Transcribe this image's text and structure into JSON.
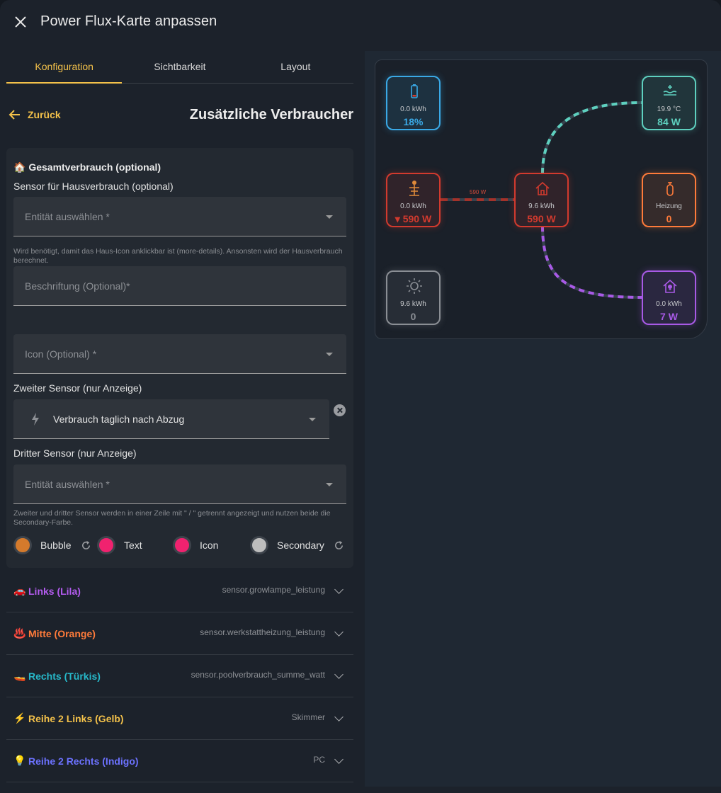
{
  "header": {
    "title": "Power Flux-Karte anpassen",
    "close_icon": "close-icon"
  },
  "tabs": [
    {
      "label": "Konfiguration",
      "active": true
    },
    {
      "label": "Sichtbarkeit",
      "active": false
    },
    {
      "label": "Layout",
      "active": false
    }
  ],
  "nav": {
    "back_label": "Zurück",
    "section_title": "Zusätzliche Verbraucher"
  },
  "form": {
    "heading": "Gesamtverbrauch (optional)",
    "heading_emoji": "🏠",
    "sensor_label": "Sensor für Hausverbrauch (optional)",
    "sensor_placeholder": "Entität auswählen *",
    "sensor_help": "Wird benötigt, damit das Haus-Icon anklickbar ist (more-details). Ansonsten wird der Hausverbrauch berechnet.",
    "caption_placeholder": "Beschriftung (Optional)*",
    "icon_placeholder": "Icon (Optional) *",
    "second_label": "Zweiter Sensor (nur Anzeige)",
    "second_value": "Verbrauch taglich nach Abzug",
    "third_label": "Dritter Sensor (nur Anzeige)",
    "third_placeholder": "Entität auswählen *",
    "third_help": "Zweiter und dritter Sensor werden in einer Zeile mit \" / \" getrennt angezeigt und nutzen beide die Secondary-Farbe.",
    "colors": [
      {
        "label": "Bubble",
        "color": "#d47a2c"
      },
      {
        "label": "Text",
        "color": "#f0226f"
      },
      {
        "label": "Icon",
        "color": "#f0226f"
      },
      {
        "label": "Secondary",
        "color": "#bdbdbd"
      }
    ]
  },
  "accordions": [
    {
      "emoji": "🚗",
      "title": "Links (Lila)",
      "value": "sensor.growlampe_leistung",
      "color": "#b45cf0"
    },
    {
      "emoji": "♨️",
      "title": "Mitte (Orange)",
      "value": "sensor.werkstattheizung_leistung",
      "color": "#ff7b3a"
    },
    {
      "emoji": "🚤",
      "title": "Rechts (Türkis)",
      "value": "sensor.poolverbrauch_summe_watt",
      "color": "#27b8c9"
    },
    {
      "emoji": "⚡",
      "title": "Reihe 2 Links (Gelb)",
      "value": "Skimmer",
      "color": "#f3c14a"
    },
    {
      "emoji": "💡",
      "title": "Reihe 2 Rechts (Indigo)",
      "value": "PC",
      "color": "#6c72ff"
    }
  ],
  "preview": {
    "flow_label": "590 W",
    "nodes": {
      "battery": {
        "sub": "0.0 kWh",
        "value": "18%",
        "color": "#3aa9e6"
      },
      "pool": {
        "sub": "19.9 °C",
        "value": "84 W",
        "color": "#5ed0bf"
      },
      "grid": {
        "sub": "0.0 kWh",
        "value": "▾ 590 W",
        "color": "#d23a2e"
      },
      "home": {
        "sub": "9.6 kWh",
        "value": "590 W",
        "color": "#d23a2e"
      },
      "heating": {
        "sub": "Heizung",
        "value": "0",
        "color": "#ff7b3a"
      },
      "solar": {
        "sub": "9.6 kWh",
        "value": "0",
        "color": "#8a8e94"
      },
      "pc": {
        "sub": "0.0 kWh",
        "value": "7 W",
        "color": "#a85ae6"
      }
    }
  }
}
